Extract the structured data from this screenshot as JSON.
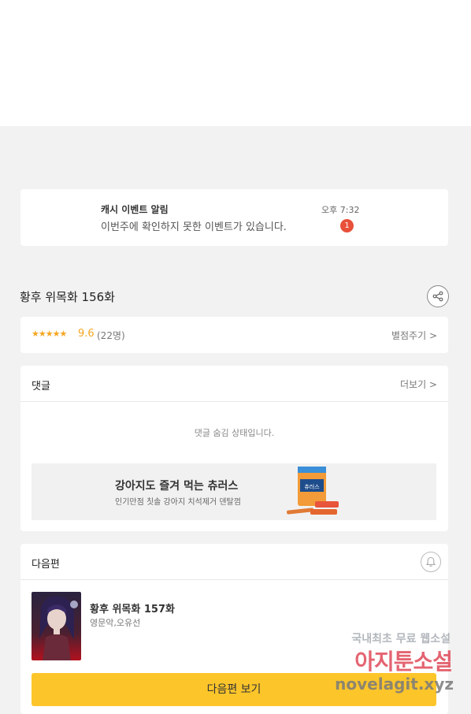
{
  "notification": {
    "title": "캐시 이벤트 알림",
    "message": "이번주에 확인하지 못한 이벤트가 있습니다.",
    "time": "오후 7:32",
    "badge": "1"
  },
  "episode": {
    "title": "황후 위목화 156화",
    "share_icon": "share-icon"
  },
  "rating": {
    "stars": "★★★★★",
    "score": "9.6",
    "count": "(22명)",
    "rate_link": "별점주기 >"
  },
  "comments": {
    "title": "댓글",
    "more_link": "더보기 >",
    "hidden_message": "댓글 숨김 상태입니다."
  },
  "ad": {
    "title": "강아지도 즐겨 먹는 츄러스",
    "subtitle": "인기만점 칫솔 강아지 치석제거 덴탈껌",
    "package_text": "츄러스"
  },
  "next_episode": {
    "section_title": "다음편",
    "bell_icon": "bell-icon",
    "title": "황후 위목화 157화",
    "authors": "영문악,오유선",
    "button_label": "다음편 보기"
  },
  "watermark": {
    "line1": "국내최초 무료 웹소설",
    "line2": "아지툰소설",
    "line3": "novelagit.xyz"
  },
  "colors": {
    "accent_yellow": "#fcc52a",
    "star_orange": "#f5a623",
    "badge_red": "#e8503a"
  }
}
